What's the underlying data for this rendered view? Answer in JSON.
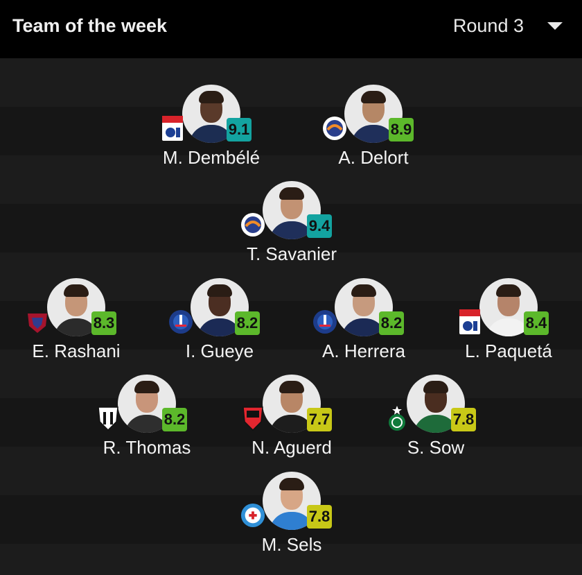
{
  "header": {
    "title": "Team of the week",
    "round_label": "Round 3"
  },
  "colors": {
    "rating_top": "#13a3a0",
    "rating_high": "#5cb82b",
    "rating_mid": "#c8c817"
  },
  "players": [
    {
      "name": "M. Dembélé",
      "rating": "9.1",
      "rating_color": "#13a3a0",
      "club_icon": "lyon-crest-icon",
      "skin": "#5a3a2a",
      "kit": "#1c2d52"
    },
    {
      "name": "A. Delort",
      "rating": "8.9",
      "rating_color": "#5cb82b",
      "club_icon": "montpellier-crest-icon",
      "skin": "#b58766",
      "kit": "#1f2f5a"
    },
    {
      "name": "T. Savanier",
      "rating": "9.4",
      "rating_color": "#13a3a0",
      "club_icon": "montpellier-crest-icon",
      "skin": "#c29273",
      "kit": "#1f2f5a"
    },
    {
      "name": "E. Rashani",
      "rating": "8.3",
      "rating_color": "#5cb82b",
      "club_icon": "clermont-crest-icon",
      "skin": "#c59678",
      "kit": "#2b2b2b"
    },
    {
      "name": "I. Gueye",
      "rating": "8.2",
      "rating_color": "#5cb82b",
      "club_icon": "psg-crest-icon",
      "skin": "#4b2e22",
      "kit": "#1b2a55"
    },
    {
      "name": "A. Herrera",
      "rating": "8.2",
      "rating_color": "#5cb82b",
      "club_icon": "psg-crest-icon",
      "skin": "#c69a7e",
      "kit": "#1b2a55"
    },
    {
      "name": "L. Paquetá",
      "rating": "8.4",
      "rating_color": "#5cb82b",
      "club_icon": "lyon-crest-icon",
      "skin": "#b5846a",
      "kit": "#f2f2f2"
    },
    {
      "name": "R. Thomas",
      "rating": "8.2",
      "rating_color": "#5cb82b",
      "club_icon": "angers-crest-icon",
      "skin": "#c8957a",
      "kit": "#2e2e2e"
    },
    {
      "name": "N. Aguerd",
      "rating": "7.7",
      "rating_color": "#c8c817",
      "club_icon": "rennes-crest-icon",
      "skin": "#b88666",
      "kit": "#1d1d1d"
    },
    {
      "name": "S. Sow",
      "rating": "7.8",
      "rating_color": "#c8c817",
      "club_icon": "saint-etienne-crest-icon",
      "skin": "#4a2d20",
      "kit": "#1e6b3a"
    },
    {
      "name": "M. Sels",
      "rating": "7.8",
      "rating_color": "#c8c817",
      "club_icon": "strasbourg-crest-icon",
      "skin": "#d7a686",
      "kit": "#2f7fd1"
    }
  ]
}
